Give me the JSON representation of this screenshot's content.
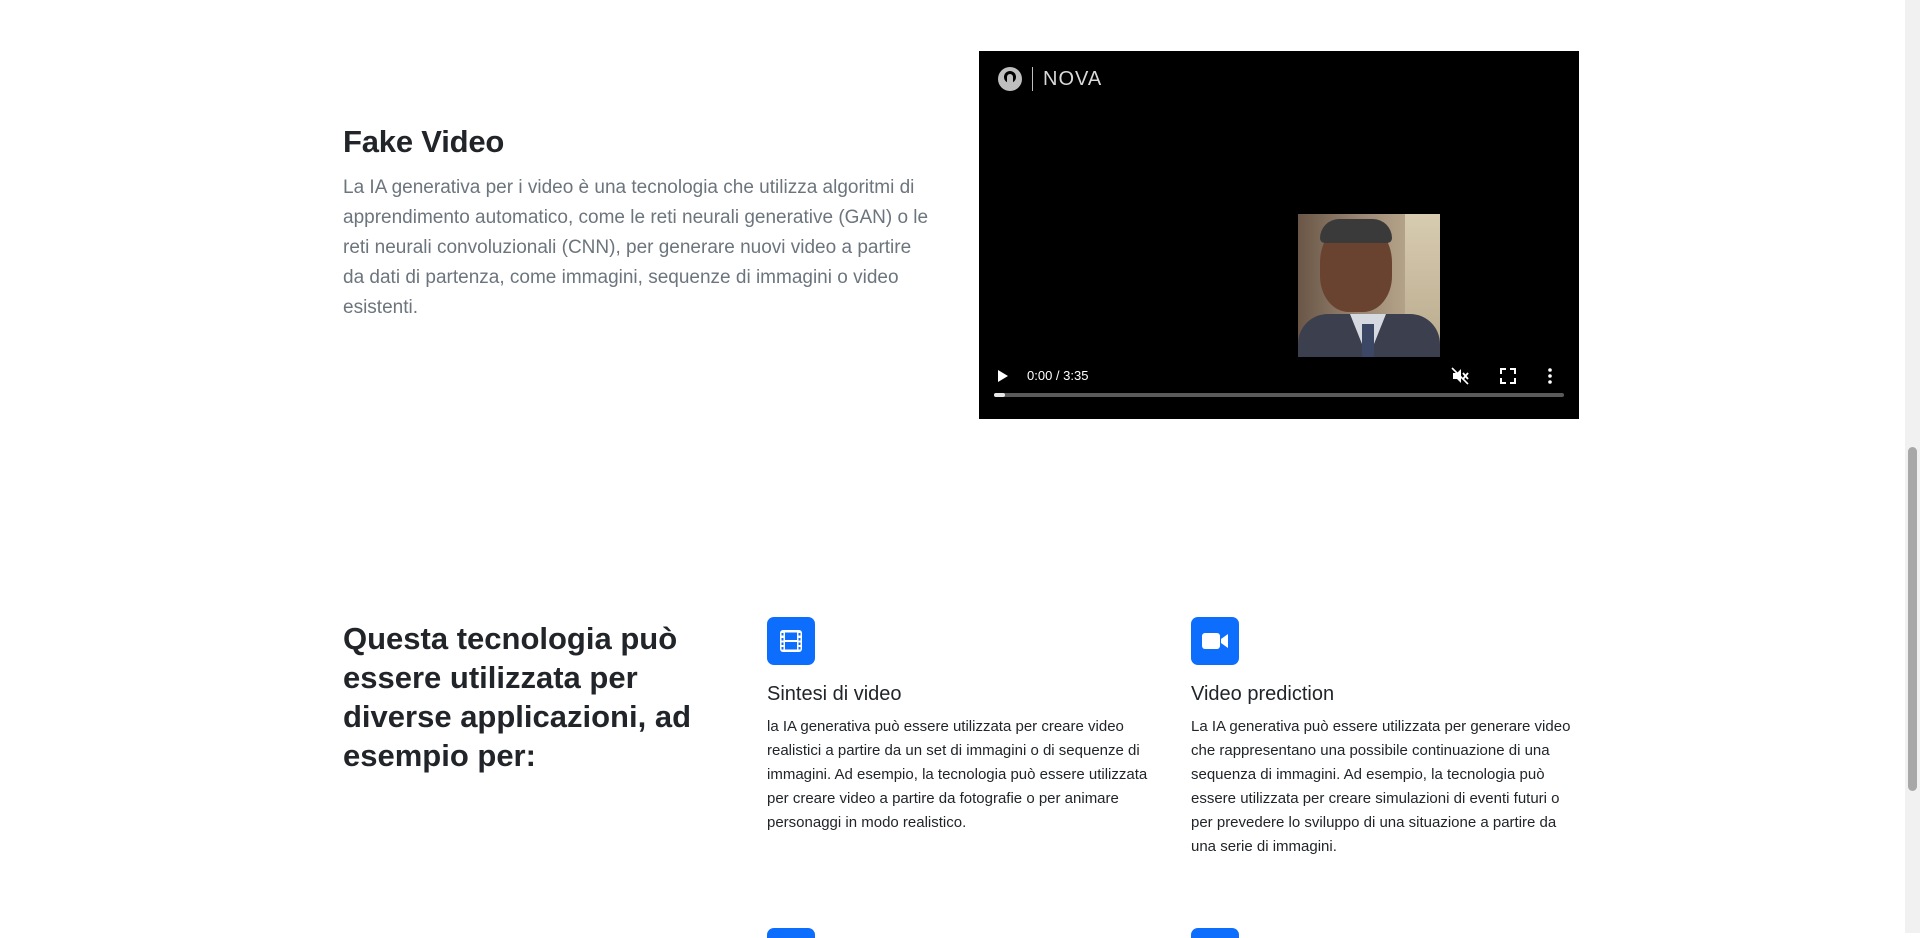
{
  "fake_video": {
    "title": "Fake Video",
    "description": "La IA generativa per i video è una tecnologia che utilizza algoritmi di apprendimento automatico, come le reti neurali generative (GAN) o le reti neurali convoluzionali (CNN), per generare nuovi video a partire da dati di partenza, come immagini, sequenze di immagini o video esistenti."
  },
  "video_player": {
    "logo_text": "NOVA",
    "time": "0:00 / 3:35",
    "progress_fraction": 0.02,
    "icons": [
      "pbs-logo-icon",
      "play-icon",
      "mute-icon",
      "fullscreen-icon",
      "more-options-icon"
    ]
  },
  "applications": {
    "title": "Questa tecnologia può essere utilizzata per diverse applicazioni, ad esempio per:",
    "items": [
      {
        "icon": "film-icon",
        "title": "Sintesi di video",
        "text": "la IA generativa può essere utilizzata per creare video realistici a partire da un set di immagini o di sequenze di immagini. Ad esempio, la tecnologia può essere utilizzata per creare video a partire da fotografie o per animare personaggi in modo realistico."
      },
      {
        "icon": "video-camera-icon",
        "title": "Video prediction",
        "text": "La IA generativa può essere utilizzata per generare video che rappresentano una possibile continuazione di una sequenza di immagini. Ad esempio, la tecnologia può essere utilizzata per creare simulazioni di eventi futuri o per prevedere lo sviluppo di una situazione a partire da una serie di immagini."
      }
    ]
  },
  "colors": {
    "accent": "#0d6efd",
    "text": "#212529",
    "muted_text": "#6c757d",
    "video_bg": "#000000"
  }
}
